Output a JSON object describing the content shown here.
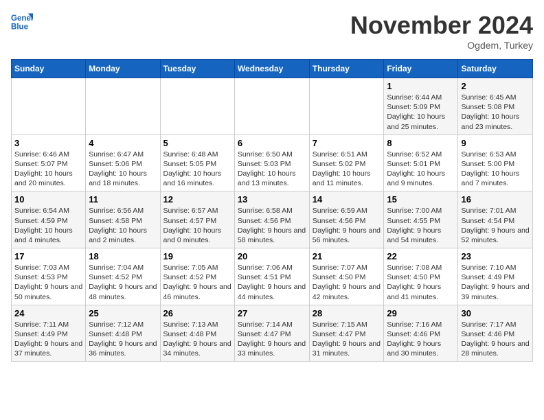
{
  "header": {
    "logo_line1": "General",
    "logo_line2": "Blue",
    "month": "November 2024",
    "location": "Ogdem, Turkey"
  },
  "days_of_week": [
    "Sunday",
    "Monday",
    "Tuesday",
    "Wednesday",
    "Thursday",
    "Friday",
    "Saturday"
  ],
  "weeks": [
    [
      {
        "day": "",
        "info": ""
      },
      {
        "day": "",
        "info": ""
      },
      {
        "day": "",
        "info": ""
      },
      {
        "day": "",
        "info": ""
      },
      {
        "day": "",
        "info": ""
      },
      {
        "day": "1",
        "info": "Sunrise: 6:44 AM\nSunset: 5:09 PM\nDaylight: 10 hours and 25 minutes."
      },
      {
        "day": "2",
        "info": "Sunrise: 6:45 AM\nSunset: 5:08 PM\nDaylight: 10 hours and 23 minutes."
      }
    ],
    [
      {
        "day": "3",
        "info": "Sunrise: 6:46 AM\nSunset: 5:07 PM\nDaylight: 10 hours and 20 minutes."
      },
      {
        "day": "4",
        "info": "Sunrise: 6:47 AM\nSunset: 5:06 PM\nDaylight: 10 hours and 18 minutes."
      },
      {
        "day": "5",
        "info": "Sunrise: 6:48 AM\nSunset: 5:05 PM\nDaylight: 10 hours and 16 minutes."
      },
      {
        "day": "6",
        "info": "Sunrise: 6:50 AM\nSunset: 5:03 PM\nDaylight: 10 hours and 13 minutes."
      },
      {
        "day": "7",
        "info": "Sunrise: 6:51 AM\nSunset: 5:02 PM\nDaylight: 10 hours and 11 minutes."
      },
      {
        "day": "8",
        "info": "Sunrise: 6:52 AM\nSunset: 5:01 PM\nDaylight: 10 hours and 9 minutes."
      },
      {
        "day": "9",
        "info": "Sunrise: 6:53 AM\nSunset: 5:00 PM\nDaylight: 10 hours and 7 minutes."
      }
    ],
    [
      {
        "day": "10",
        "info": "Sunrise: 6:54 AM\nSunset: 4:59 PM\nDaylight: 10 hours and 4 minutes."
      },
      {
        "day": "11",
        "info": "Sunrise: 6:56 AM\nSunset: 4:58 PM\nDaylight: 10 hours and 2 minutes."
      },
      {
        "day": "12",
        "info": "Sunrise: 6:57 AM\nSunset: 4:57 PM\nDaylight: 10 hours and 0 minutes."
      },
      {
        "day": "13",
        "info": "Sunrise: 6:58 AM\nSunset: 4:56 PM\nDaylight: 9 hours and 58 minutes."
      },
      {
        "day": "14",
        "info": "Sunrise: 6:59 AM\nSunset: 4:56 PM\nDaylight: 9 hours and 56 minutes."
      },
      {
        "day": "15",
        "info": "Sunrise: 7:00 AM\nSunset: 4:55 PM\nDaylight: 9 hours and 54 minutes."
      },
      {
        "day": "16",
        "info": "Sunrise: 7:01 AM\nSunset: 4:54 PM\nDaylight: 9 hours and 52 minutes."
      }
    ],
    [
      {
        "day": "17",
        "info": "Sunrise: 7:03 AM\nSunset: 4:53 PM\nDaylight: 9 hours and 50 minutes."
      },
      {
        "day": "18",
        "info": "Sunrise: 7:04 AM\nSunset: 4:52 PM\nDaylight: 9 hours and 48 minutes."
      },
      {
        "day": "19",
        "info": "Sunrise: 7:05 AM\nSunset: 4:52 PM\nDaylight: 9 hours and 46 minutes."
      },
      {
        "day": "20",
        "info": "Sunrise: 7:06 AM\nSunset: 4:51 PM\nDaylight: 9 hours and 44 minutes."
      },
      {
        "day": "21",
        "info": "Sunrise: 7:07 AM\nSunset: 4:50 PM\nDaylight: 9 hours and 42 minutes."
      },
      {
        "day": "22",
        "info": "Sunrise: 7:08 AM\nSunset: 4:50 PM\nDaylight: 9 hours and 41 minutes."
      },
      {
        "day": "23",
        "info": "Sunrise: 7:10 AM\nSunset: 4:49 PM\nDaylight: 9 hours and 39 minutes."
      }
    ],
    [
      {
        "day": "24",
        "info": "Sunrise: 7:11 AM\nSunset: 4:49 PM\nDaylight: 9 hours and 37 minutes."
      },
      {
        "day": "25",
        "info": "Sunrise: 7:12 AM\nSunset: 4:48 PM\nDaylight: 9 hours and 36 minutes."
      },
      {
        "day": "26",
        "info": "Sunrise: 7:13 AM\nSunset: 4:48 PM\nDaylight: 9 hours and 34 minutes."
      },
      {
        "day": "27",
        "info": "Sunrise: 7:14 AM\nSunset: 4:47 PM\nDaylight: 9 hours and 33 minutes."
      },
      {
        "day": "28",
        "info": "Sunrise: 7:15 AM\nSunset: 4:47 PM\nDaylight: 9 hours and 31 minutes."
      },
      {
        "day": "29",
        "info": "Sunrise: 7:16 AM\nSunset: 4:46 PM\nDaylight: 9 hours and 30 minutes."
      },
      {
        "day": "30",
        "info": "Sunrise: 7:17 AM\nSunset: 4:46 PM\nDaylight: 9 hours and 28 minutes."
      }
    ]
  ]
}
